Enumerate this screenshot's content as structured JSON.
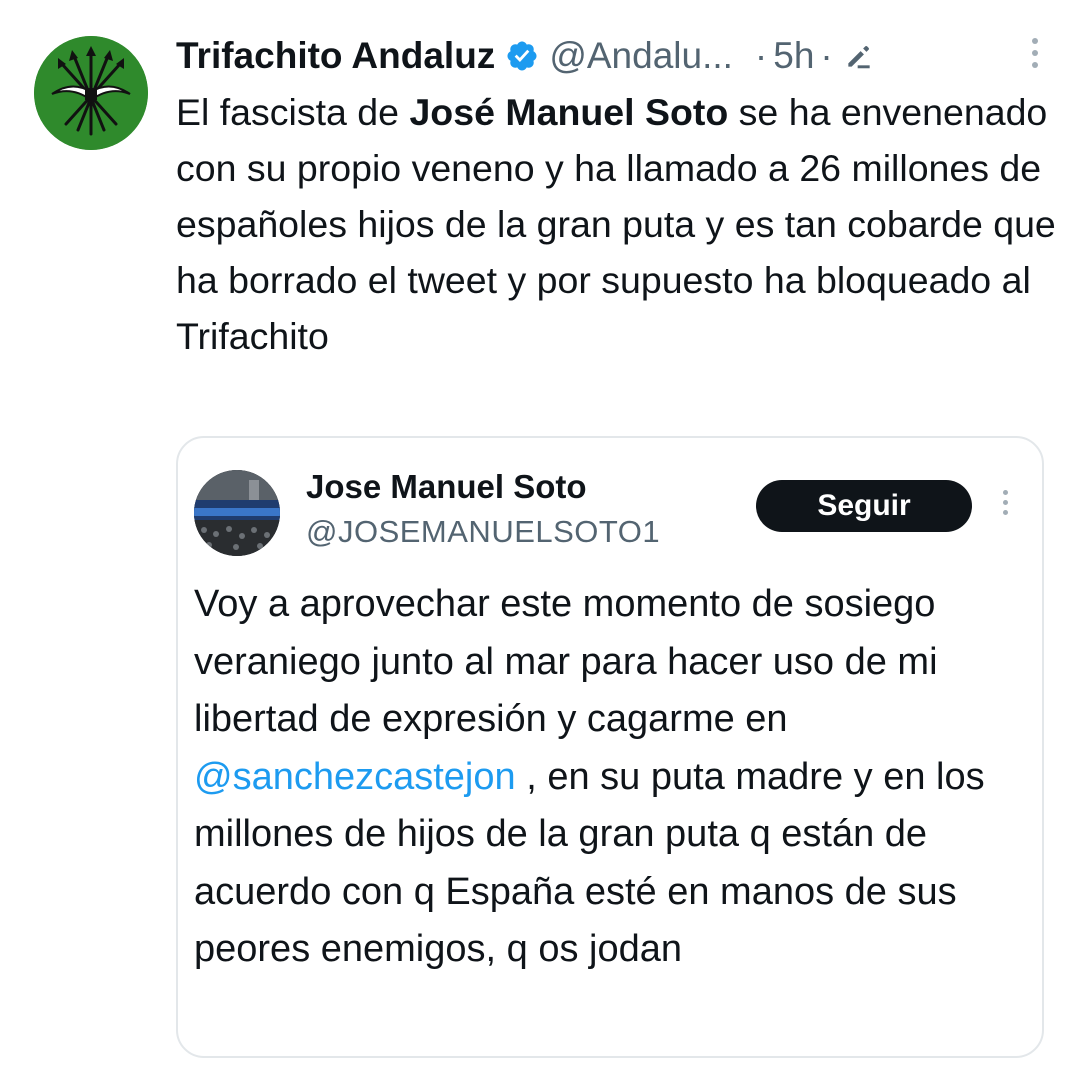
{
  "tweet": {
    "display_name": "Trifachito Andaluz",
    "handle": "@Andalu...",
    "separator": "·",
    "time": "5h",
    "separator2": "·",
    "text_parts": {
      "p1": "El fascista de ",
      "bold": "José Manuel Soto",
      "p2": " se ha envenenado con su propio veneno y ha llamado a 26 millones de españoles hijos de la gran puta y es tan cobarde que ha borrado el tweet y por supuesto ha bloqueado al Trifachito"
    },
    "icons": {
      "avatar": "falange-yoke-arrows-avatar",
      "verified": "verified-badge-icon",
      "edit": "edited-pencil-icon",
      "more": "more-vertical-icon"
    }
  },
  "quoted": {
    "display_name": "Jose Manuel Soto",
    "handle": "@JOSEMANUELSOTO1",
    "follow_label": "Seguir",
    "text_parts": {
      "p1": "Voy a aprovechar este momento de sosiego veraniego junto al mar para hacer uso de mi libertad de expresión y cagarme en ",
      "mention": "@sanchezcastejon",
      "p2": " , en su puta madre y en los millones de hijos de la gran puta q están de acuerdo con q España esté en manos de sus peores enemigos, q os jodan"
    },
    "icons": {
      "avatar": "concert-crowd-avatar",
      "more": "more-vertical-icon"
    }
  },
  "colors": {
    "text": "#0f1419",
    "secondary": "#536471",
    "verified": "#1d9bf0",
    "mention": "#1d9bf0",
    "avatar_green": "#2f8a2c",
    "follow_bg": "#0f1419",
    "border": "#e3e7ea"
  }
}
